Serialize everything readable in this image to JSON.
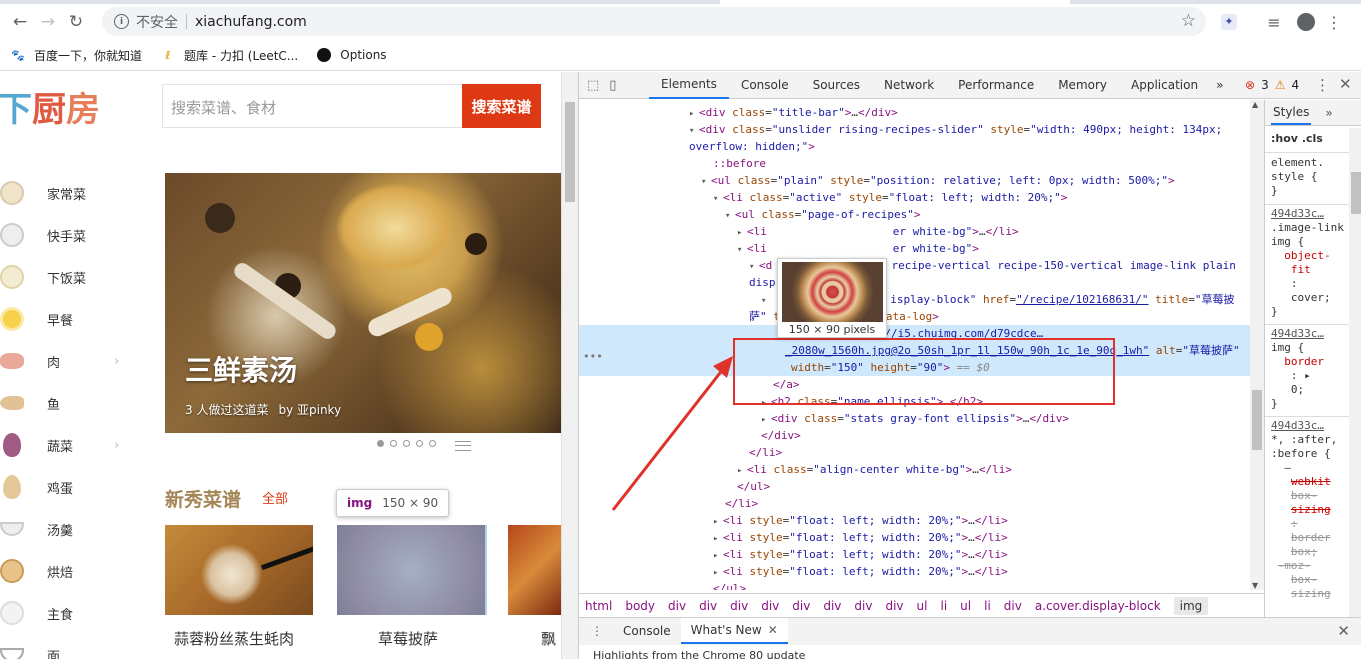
{
  "browser": {
    "security": "不安全",
    "url": "xiachufang.com",
    "bookmarks": [
      "百度一下，你就知道",
      "题库 - 力扣 (LeetC...",
      "Options"
    ]
  },
  "site": {
    "logo": [
      "下",
      "厨",
      "房"
    ],
    "search_placeholder": "搜索菜谱、食材",
    "search_button": "搜索菜谱",
    "categories": [
      "家常菜",
      "快手菜",
      "下饭菜",
      "早餐",
      "肉",
      "鱼",
      "蔬菜",
      "鸡蛋",
      "汤羹",
      "烘焙",
      "主食",
      "面"
    ],
    "hero_title": "三鲜素汤",
    "hero_count": "3 人做过这道菜",
    "hero_author": "by 亚pinky",
    "section_title": "新秀菜谱",
    "section_all": "全部",
    "cards": [
      "蒜蓉粉丝蒸生蚝肉",
      "草莓披萨",
      "飘"
    ],
    "tooltip_tag": "img",
    "tooltip_dim": "150 × 90"
  },
  "devtools": {
    "tabs": [
      "Elements",
      "Console",
      "Sources",
      "Network",
      "Performance",
      "Memory",
      "Application"
    ],
    "errors": "3",
    "warnings": "4",
    "img_preview_caption": "150 × 90 pixels",
    "breadcrumbs": [
      "html",
      "body",
      "div",
      "div",
      "div",
      "div",
      "div",
      "div",
      "div",
      "div",
      "ul",
      "li",
      "ul",
      "li",
      "div",
      "a.cover.display-block",
      "img"
    ],
    "styles_tab": "Styles",
    "hov": ":hov",
    "cls": ".cls",
    "drawer_tabs": [
      "Console",
      "What's New"
    ],
    "drawer_text": "Highlights from the Chrome 80 update"
  },
  "colors": {
    "brand_red": "#dd3915",
    "selection": "#cfe8fc",
    "annotation": "#e0322a"
  }
}
